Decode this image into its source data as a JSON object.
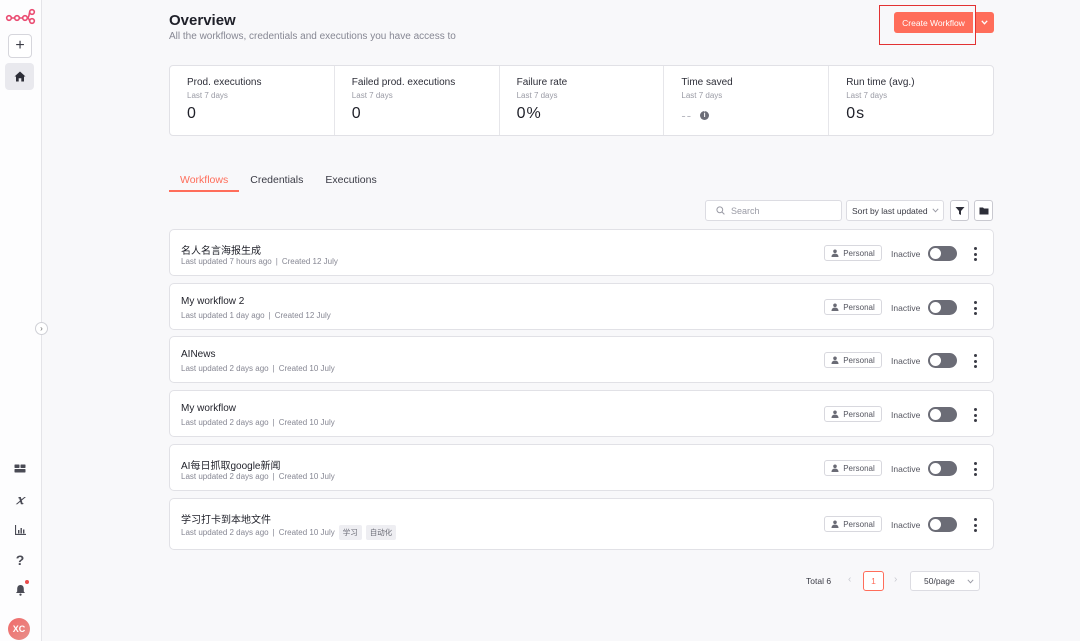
{
  "sidebar": {
    "logo_icon": "n8n-logo-icon",
    "add_icon": "plus-icon",
    "home_icon": "home-icon",
    "bottom_icons": [
      "templates-icon",
      "variables-icon",
      "insights-icon",
      "help-icon",
      "bell-icon"
    ],
    "avatar_initials": "XC"
  },
  "header": {
    "title": "Overview",
    "subtitle": "All the workflows, credentials and executions you have access to",
    "create_button": "Create Workflow"
  },
  "stats": [
    {
      "label": "Prod. executions",
      "sub": "Last 7 days",
      "value": "0"
    },
    {
      "label": "Failed prod. executions",
      "sub": "Last 7 days",
      "value": "0"
    },
    {
      "label": "Failure rate",
      "sub": "Last 7 days",
      "value": "0%"
    },
    {
      "label": "Time saved",
      "sub": "Last 7 days",
      "value": "--"
    },
    {
      "label": "Run time (avg.)",
      "sub": "Last 7 days",
      "value": "0s"
    }
  ],
  "tabs": [
    "Workflows",
    "Credentials",
    "Executions"
  ],
  "toolbar": {
    "search_placeholder": "Search",
    "sort_label": "Sort by last updated"
  },
  "workflows": [
    {
      "name": "名人名言海报生成",
      "updated": "Last updated 7 hours ago",
      "created": "Created 12 July",
      "owner": "Personal",
      "status": "Inactive",
      "tags": []
    },
    {
      "name": "My workflow 2",
      "updated": "Last updated 1 day ago",
      "created": "Created 12 July",
      "owner": "Personal",
      "status": "Inactive",
      "tags": []
    },
    {
      "name": "AINews",
      "updated": "Last updated 2 days ago",
      "created": "Created 10 July",
      "owner": "Personal",
      "status": "Inactive",
      "tags": []
    },
    {
      "name": "My workflow",
      "updated": "Last updated 2 days ago",
      "created": "Created 10 July",
      "owner": "Personal",
      "status": "Inactive",
      "tags": []
    },
    {
      "name": "AI每日抓取google新闻",
      "updated": "Last updated 2 days ago",
      "created": "Created 10 July",
      "owner": "Personal",
      "status": "Inactive",
      "tags": []
    },
    {
      "name": "学习打卡到本地文件",
      "updated": "Last updated 2 days ago",
      "created": "Created 10 July",
      "owner": "Personal",
      "status": "Inactive",
      "tags": [
        "学习",
        "自动化"
      ]
    }
  ],
  "pagination": {
    "total": "Total 6",
    "current_page": "1",
    "page_size": "50/page"
  },
  "colors": {
    "accent": "#ff6d5a",
    "highlight_box": "#e23232"
  }
}
